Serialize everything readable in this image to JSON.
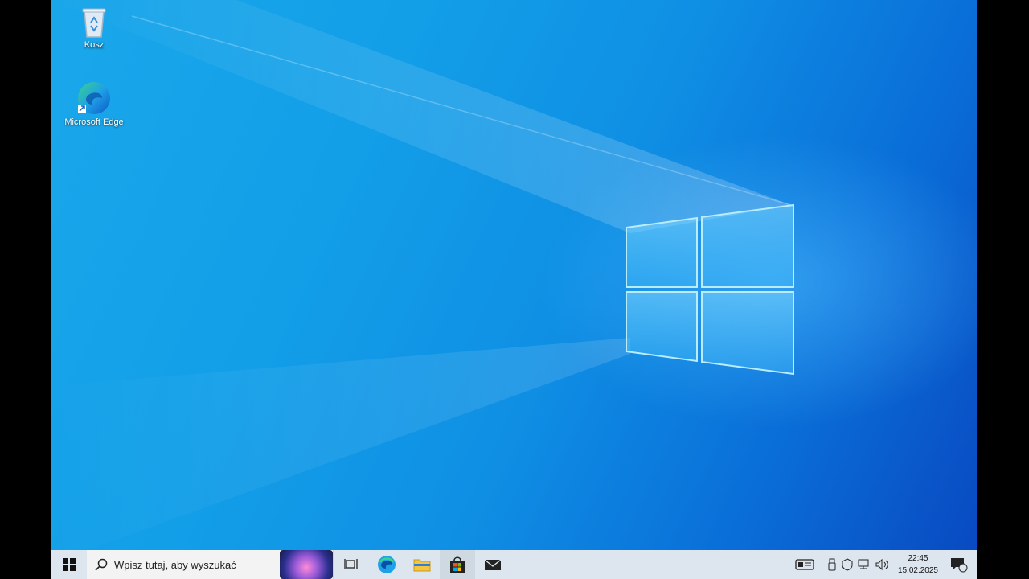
{
  "desktop": {
    "icons": [
      {
        "label": "Kosz",
        "icon": "recycle-bin-icon"
      },
      {
        "label": "Microsoft Edge",
        "icon": "edge-icon"
      }
    ]
  },
  "taskbar": {
    "start_icon": "windows-start-icon",
    "search": {
      "placeholder": "Wpisz tutaj, aby wyszukać",
      "icon": "search-icon"
    },
    "pinned": [
      {
        "name": "Widok zadań",
        "icon": "task-view-icon"
      },
      {
        "name": "Microsoft Edge",
        "icon": "edge-icon"
      },
      {
        "name": "Eksplorator plików",
        "icon": "folder-icon"
      },
      {
        "name": "Microsoft Store",
        "icon": "store-icon"
      },
      {
        "name": "Poczta",
        "icon": "mail-icon"
      }
    ],
    "tray": {
      "time": "22:45",
      "date": "15.02.2025",
      "notification_count": "1"
    }
  },
  "colors": {
    "taskbar_bg": "#dde6ee",
    "desktop_light": "#1aa7ea",
    "desktop_dark": "#0948c0"
  }
}
